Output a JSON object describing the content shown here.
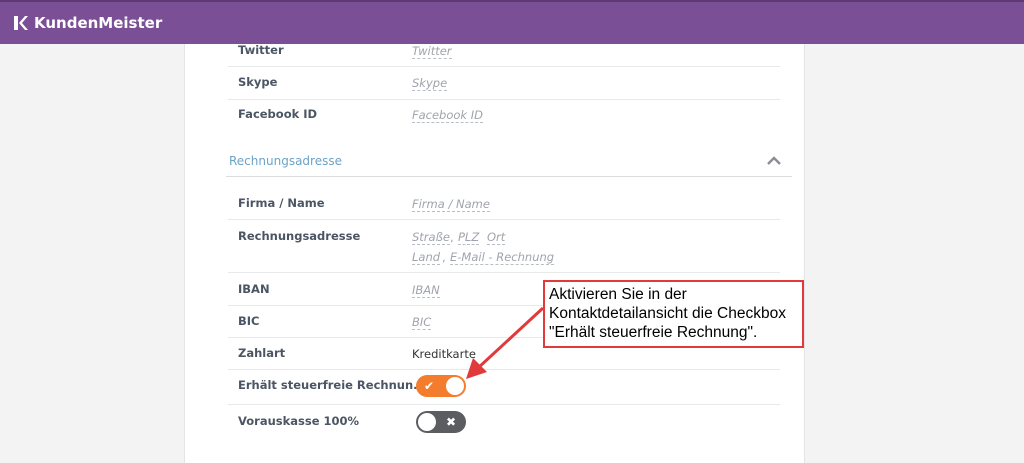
{
  "app": {
    "name": "KundenMeister"
  },
  "contact_fields": [
    {
      "label": "Twitter",
      "value": "Twitter"
    },
    {
      "label": "Skype",
      "value": "Skype"
    },
    {
      "label": "Facebook ID",
      "value": "Facebook ID"
    }
  ],
  "billing": {
    "section_title": "Rechnungsadresse",
    "firma": {
      "label": "Firma / Name",
      "value": "Firma / Name"
    },
    "address": {
      "label": "Rechnungsadresse",
      "strasse": "Straße",
      "plz": "PLZ",
      "ort": "Ort",
      "land": "Land",
      "email": "E-Mail - Rechnung",
      "sep1": ",",
      "sep2": ","
    },
    "iban": {
      "label": "IBAN",
      "value": "IBAN"
    },
    "bic": {
      "label": "BIC",
      "value": "BIC"
    },
    "zahlart": {
      "label": "Zahlart",
      "value": "Kreditkarte"
    },
    "steuerfrei": {
      "label": "Erhält steuerfreie Rechnun...",
      "checked": true,
      "icon": "check-icon",
      "glyph": "✔"
    },
    "vorauskasse": {
      "label": "Vorauskasse 100%",
      "checked": false,
      "icon": "x-icon",
      "glyph": "✖"
    }
  },
  "callout": {
    "lines": [
      "Aktivieren Sie in der",
      "Kontaktdetailansicht die Checkbox",
      "\"Erhält steuerfreie Rechnung\"."
    ]
  },
  "colors": {
    "header": "#7b4f96",
    "toggle_on": "#f37d2c",
    "toggle_off": "#5b5d61",
    "section_title": "#6aa3c9",
    "annotation": "#e03a3a"
  }
}
